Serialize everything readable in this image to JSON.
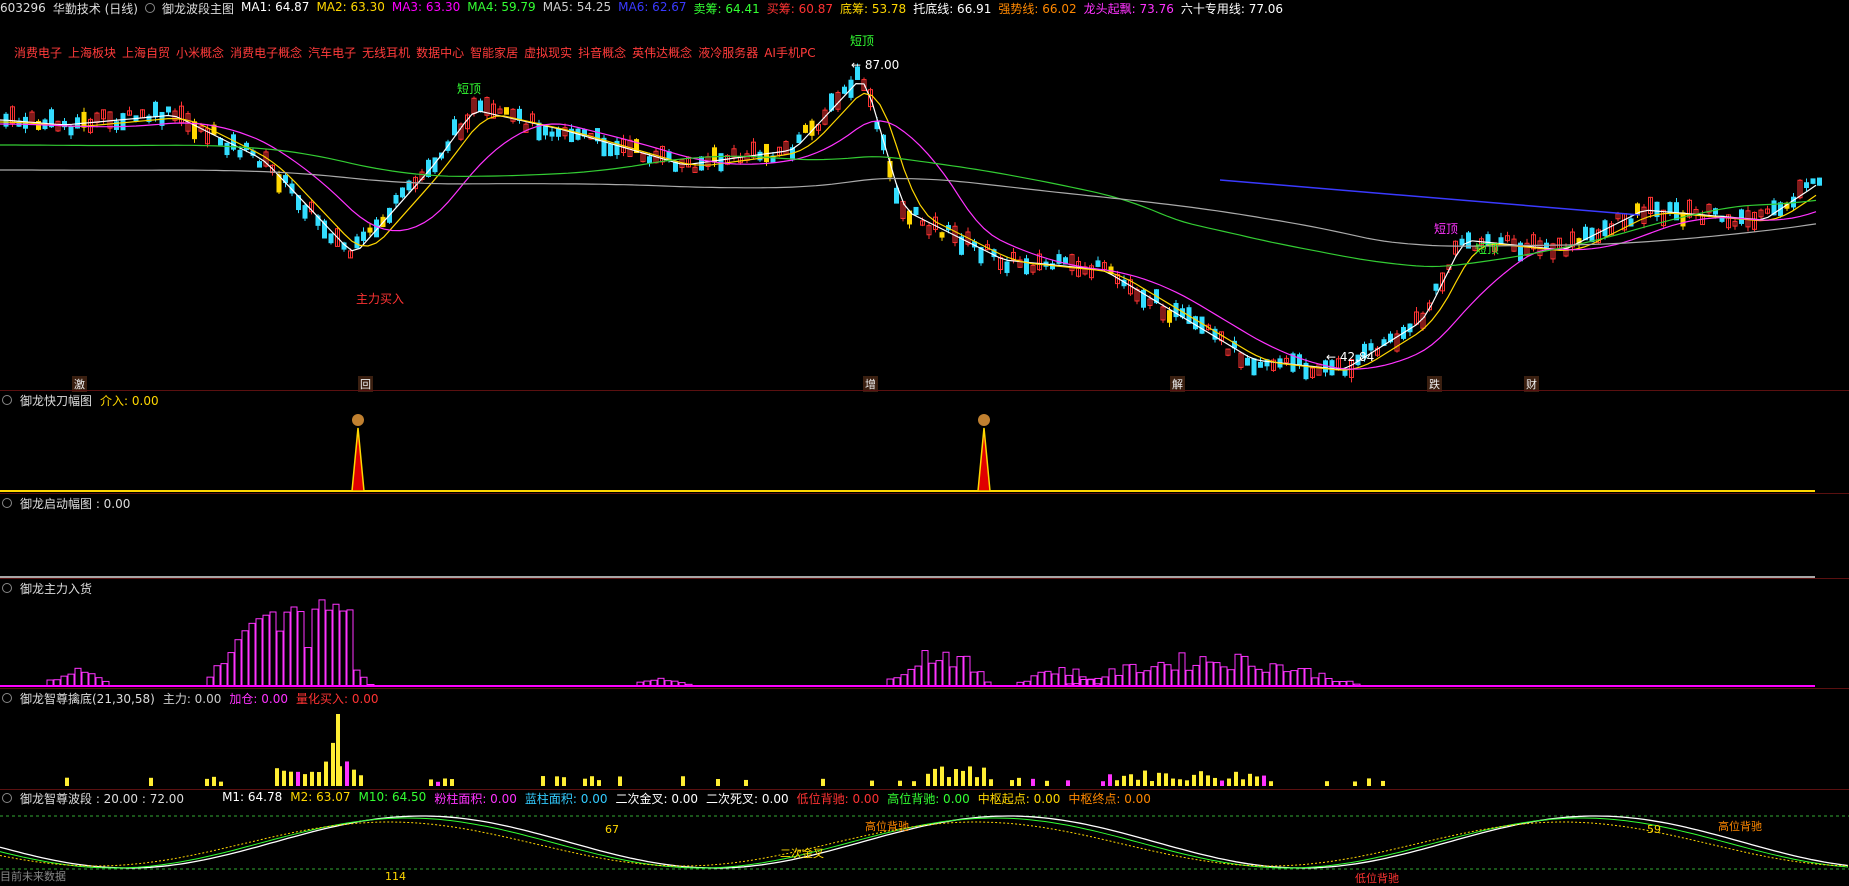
{
  "header": {
    "stock_code": "603296",
    "stock_name": "华勤技术 (日线)",
    "indicator_name": "御龙波段主图",
    "items": [
      {
        "label": "MA1: 64.87",
        "color": "#ffffff"
      },
      {
        "label": "MA2: 63.30",
        "color": "#ffd700"
      },
      {
        "label": "MA3: 63.30",
        "color": "#ff00ff"
      },
      {
        "label": "MA4: 59.79",
        "color": "#33ff33"
      },
      {
        "label": "MA5: 54.25",
        "color": "#cccccc"
      },
      {
        "label": "MA6: 62.67",
        "color": "#3a3aff"
      },
      {
        "label": "卖筹: 64.41",
        "color": "#33ff33"
      },
      {
        "label": "买筹: 60.87",
        "color": "#ff3333"
      },
      {
        "label": "底筹: 53.78",
        "color": "#ffd700"
      },
      {
        "label": "托底线: 66.91",
        "color": "#ffffff"
      },
      {
        "label": "强势线: 66.02",
        "color": "#ff8800"
      },
      {
        "label": "龙头起飘: 73.76",
        "color": "#ff33ff"
      },
      {
        "label": "六十专用线: 77.06",
        "color": "#ffffff"
      }
    ]
  },
  "concepts": [
    "消费电子",
    "上海板块",
    "上海自贸",
    "小米概念",
    "消费电子概念",
    "汽车电子",
    "无线耳机",
    "数据中心",
    "智能家居",
    "虚拟现实",
    "抖音概念",
    "英伟达概念",
    "液冷服务器",
    "AI手机PC"
  ],
  "main_chart": {
    "high_label": "87.00",
    "low_label": "42.84",
    "annotations": [
      "短顶",
      "短顶",
      "短顶",
      "短顶",
      "主力买入"
    ],
    "bottom_markers": [
      "激",
      "回",
      "增",
      "解",
      "跌",
      "财"
    ]
  },
  "panes": {
    "p1": {
      "title": "御龙快刀幅图",
      "extra": "介入: 0.00",
      "color": "#ffd700"
    },
    "p2": {
      "title": "御龙启动幅图 : 0.00"
    },
    "p3": {
      "title": "御龙主力入货"
    },
    "p4": {
      "title": "御龙智尊擒底(21,30,58)",
      "items": [
        {
          "label": "主力: 0.00",
          "color": "#cccccc"
        },
        {
          "label": "加仓: 0.00",
          "color": "#ff33ff"
        },
        {
          "label": "量化买入: 0.00",
          "color": "#ff3333"
        }
      ]
    },
    "p5": {
      "title": "御龙智尊波段 : 20.00 : 72.00",
      "items": [
        {
          "label": "M1: 64.78",
          "color": "#ffffff"
        },
        {
          "label": "M2: 63.07",
          "color": "#ffd700"
        },
        {
          "label": "M10: 64.50",
          "color": "#33ff33"
        },
        {
          "label": "粉柱面积: 0.00",
          "color": "#ff33ff"
        },
        {
          "label": "蓝柱面积: 0.00",
          "color": "#33ccff"
        },
        {
          "label": "二次金叉: 0.00",
          "color": "#ffffff"
        },
        {
          "label": "二次死叉: 0.00",
          "color": "#ffffff"
        },
        {
          "label": "低位背驰: 0.00",
          "color": "#ff3333"
        },
        {
          "label": "高位背驰: 0.00",
          "color": "#33ff33"
        },
        {
          "label": "中枢起点: 0.00",
          "color": "#ffd700"
        },
        {
          "label": "中枢终点: 0.00",
          "color": "#ff8800"
        }
      ],
      "annotations": [
        "67",
        "114",
        "59",
        "二次金叉",
        "高位背驰",
        "低位背驰",
        "高位背驰"
      ]
    }
  },
  "footer": {
    "label": "目前未来数据"
  }
}
